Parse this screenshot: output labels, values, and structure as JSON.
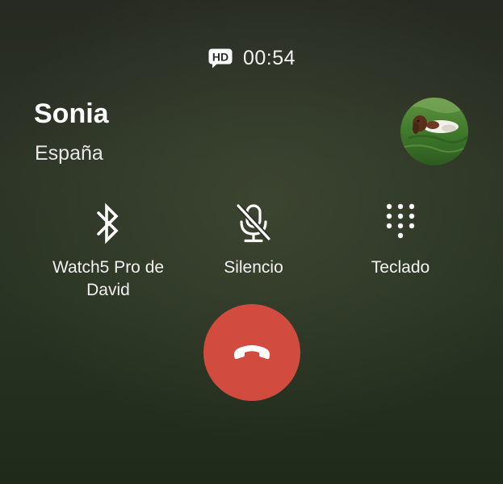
{
  "call": {
    "status_badge": "HD",
    "duration": "00:54",
    "contact_name": "Sonia",
    "location": "España"
  },
  "actions": {
    "bluetooth_label": "Watch5 Pro de David",
    "mute_label": "Silencio",
    "keypad_label": "Teclado"
  },
  "icons": {
    "hd": "hd-voice-icon",
    "bluetooth": "bluetooth-icon",
    "mute": "microphone-off-icon",
    "keypad": "dialpad-icon",
    "end_call": "phone-hangup-icon"
  },
  "colors": {
    "end_call_button": "#d24b3f",
    "text": "#ffffff"
  }
}
